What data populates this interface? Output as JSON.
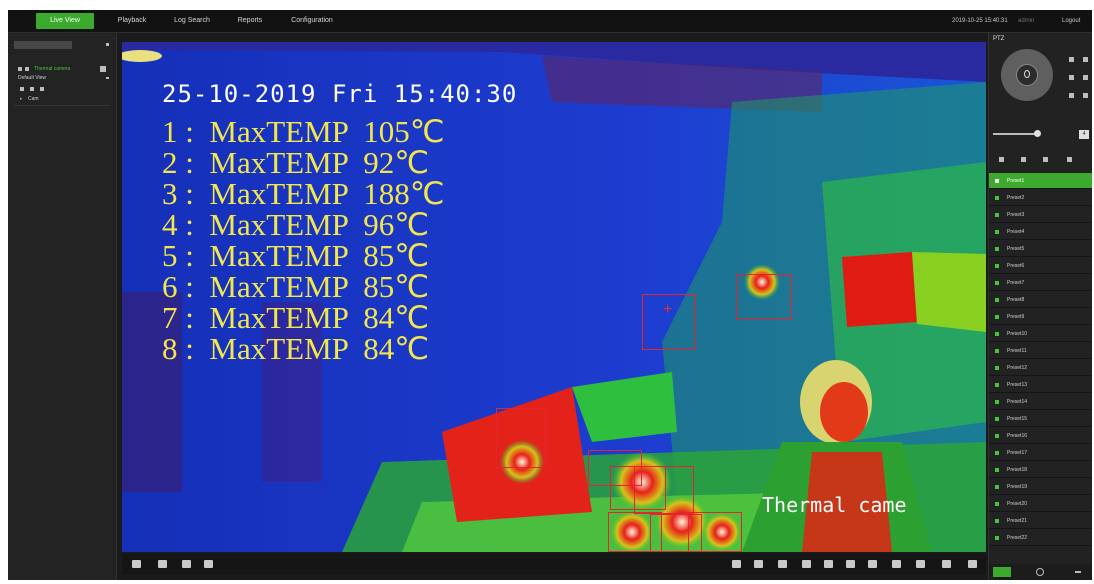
{
  "tabs": [
    {
      "label": "Live View",
      "active": true
    },
    {
      "label": "Playback",
      "active": false
    },
    {
      "label": "Log Search",
      "active": false
    },
    {
      "label": "Reports",
      "active": false
    },
    {
      "label": "Configuration",
      "active": false
    }
  ],
  "header": {
    "datetime": "2019-10-25 15:40:31",
    "user": "admin",
    "logout_label": "Logout"
  },
  "sidebar": {
    "camera_label": "Thermal camera",
    "view_label": "Default View",
    "tree_item": "Cam"
  },
  "video": {
    "timestamp": "25-10-2019 Fri 15:40:30",
    "overlay_label": "Thermal came",
    "readings": [
      {
        "index": "1",
        "label": "MaxTEMP",
        "value": "105℃"
      },
      {
        "index": "2",
        "label": "MaxTEMP",
        "value": "92℃"
      },
      {
        "index": "3",
        "label": "MaxTEMP",
        "value": "188℃"
      },
      {
        "index": "4",
        "label": "MaxTEMP",
        "value": "96℃"
      },
      {
        "index": "5",
        "label": "MaxTEMP",
        "value": "85℃"
      },
      {
        "index": "6",
        "label": "MaxTEMP",
        "value": "85℃"
      },
      {
        "index": "7",
        "label": "MaxTEMP",
        "value": "84℃"
      },
      {
        "index": "8",
        "label": "MaxTEMP",
        "value": "84℃"
      }
    ],
    "marker": "+"
  },
  "ptz": {
    "title": "PTZ",
    "speed_value": "4",
    "presets": [
      "Preset1",
      "Preset2",
      "Preset3",
      "Preset4",
      "Preset5",
      "Preset6",
      "Preset7",
      "Preset8",
      "Preset9",
      "Preset10",
      "Preset11",
      "Preset12",
      "Preset13",
      "Preset14",
      "Preset15",
      "Preset16",
      "Preset17",
      "Preset18",
      "Preset19",
      "Preset20",
      "Preset21",
      "Preset22"
    ]
  },
  "colors": {
    "accent": "#3caa2c",
    "osd_text": "#f3e64c",
    "roi_box": "#e6242f",
    "thermal_cold": "#1733c8",
    "thermal_hot": "#e01a12"
  }
}
